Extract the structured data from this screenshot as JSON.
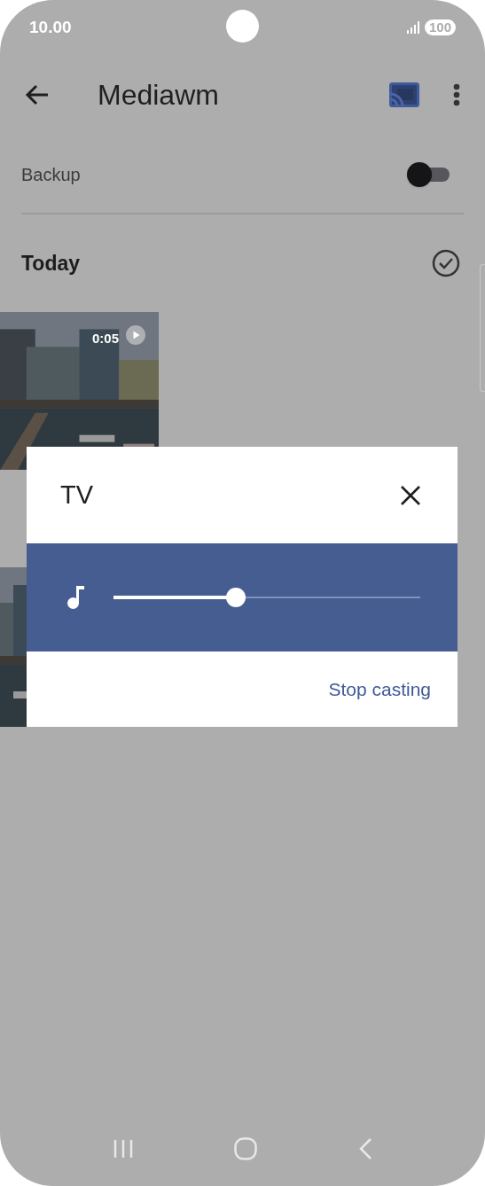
{
  "status_bar": {
    "time": "10.00",
    "battery": "100"
  },
  "app_bar": {
    "title": "Mediawm"
  },
  "backup": {
    "label": "Backup",
    "on": false
  },
  "section": {
    "title": "Today",
    "checked": false
  },
  "video": {
    "duration": "0:05"
  },
  "dialog": {
    "title": "TV",
    "volume": {
      "level": 0.4
    },
    "action": "Stop casting"
  }
}
